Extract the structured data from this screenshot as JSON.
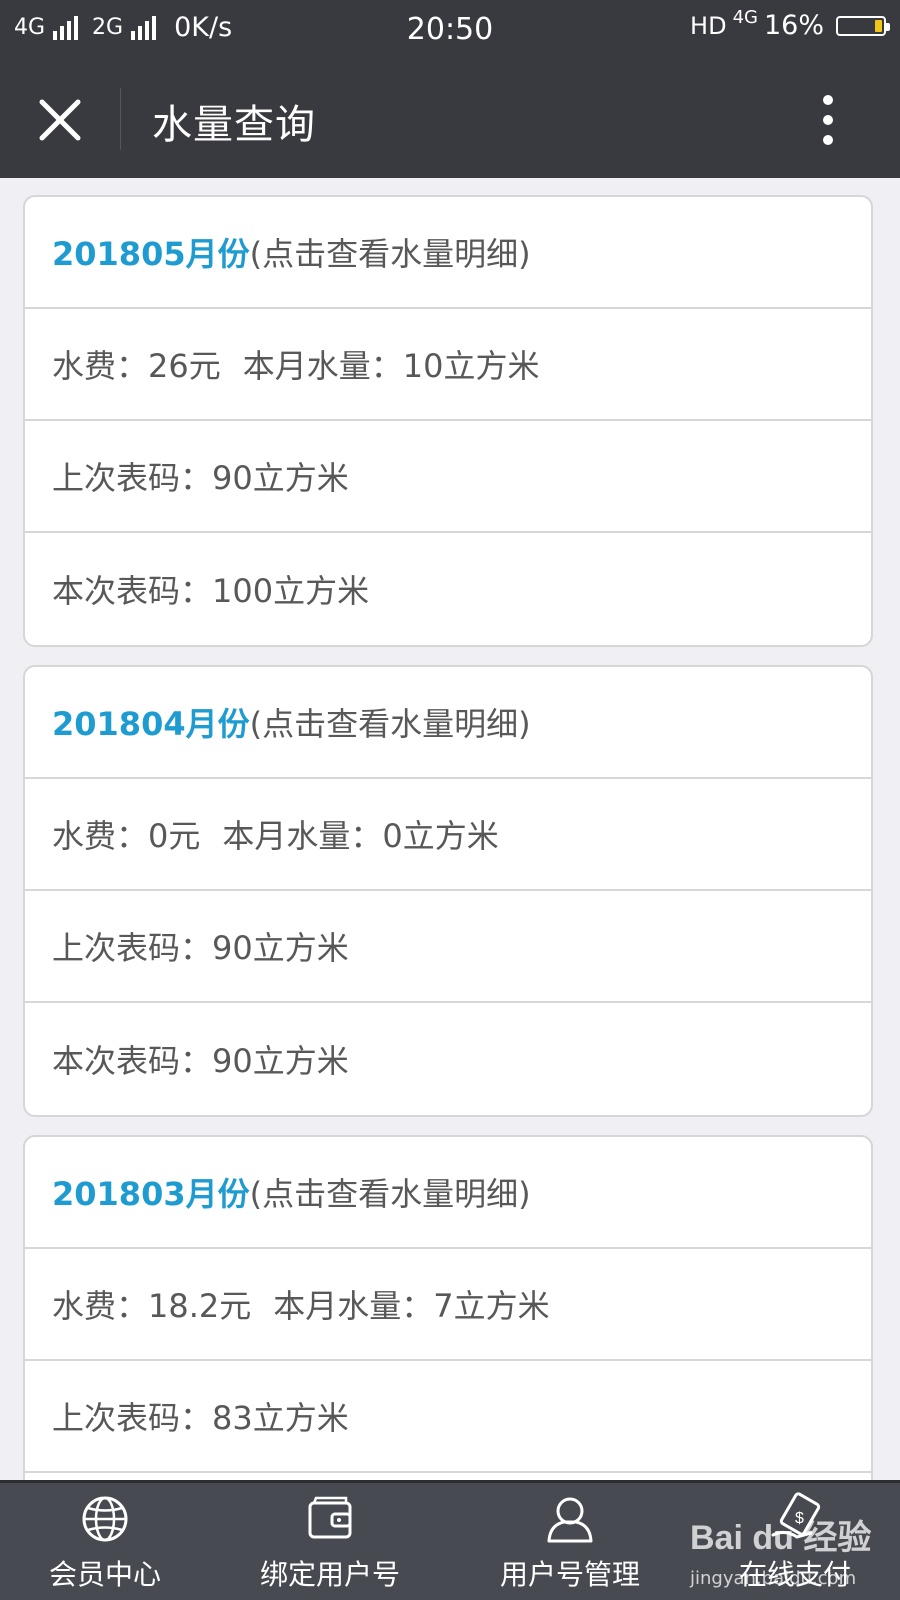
{
  "status_bar": {
    "network1": "4G",
    "network2": "2G",
    "speed": "0K/s",
    "time": "20:50",
    "hd": "HD",
    "net_type": "4G",
    "battery": "16%",
    "battery_level": 0.16,
    "battery_color": "#f3c516"
  },
  "titlebar": {
    "title": "水量查询",
    "close_icon": "close-icon",
    "more_icon": "more-vertical-icon"
  },
  "records": [
    {
      "month": "201805月份",
      "hint": "(点击查看水量明细)",
      "fee_label": "水费：",
      "fee_value": "26元",
      "usage_label": "本月水量：",
      "usage_value": "10立方米",
      "prev_label": "上次表码：",
      "prev_value": "90立方米",
      "curr_label": "本次表码：",
      "curr_value": "100立方米"
    },
    {
      "month": "201804月份",
      "hint": "(点击查看水量明细)",
      "fee_label": "水费：",
      "fee_value": "0元",
      "usage_label": "本月水量：",
      "usage_value": "0立方米",
      "prev_label": "上次表码：",
      "prev_value": "90立方米",
      "curr_label": "本次表码：",
      "curr_value": "90立方米"
    },
    {
      "month": "201803月份",
      "hint": "(点击查看水量明细)",
      "fee_label": "水费：",
      "fee_value": "18.2元",
      "usage_label": "本月水量：",
      "usage_value": "7立方米",
      "prev_label": "上次表码：",
      "prev_value": "83立方米"
    }
  ],
  "bottom_nav": [
    {
      "label": "会员中心",
      "icon": "globe-icon"
    },
    {
      "label": "绑定用户号",
      "icon": "wallet-icon"
    },
    {
      "label": "用户号管理",
      "icon": "user-icon"
    },
    {
      "label": "在线支付",
      "icon": "payment-icon"
    }
  ],
  "watermark": {
    "brand": "Bai du 经验",
    "url": "jingyan.baidu.com"
  },
  "colors": {
    "header_bg": "#393a3f",
    "page_bg": "#efeff4",
    "accent": "#1e9bd0",
    "nav_bg": "#474a50"
  }
}
